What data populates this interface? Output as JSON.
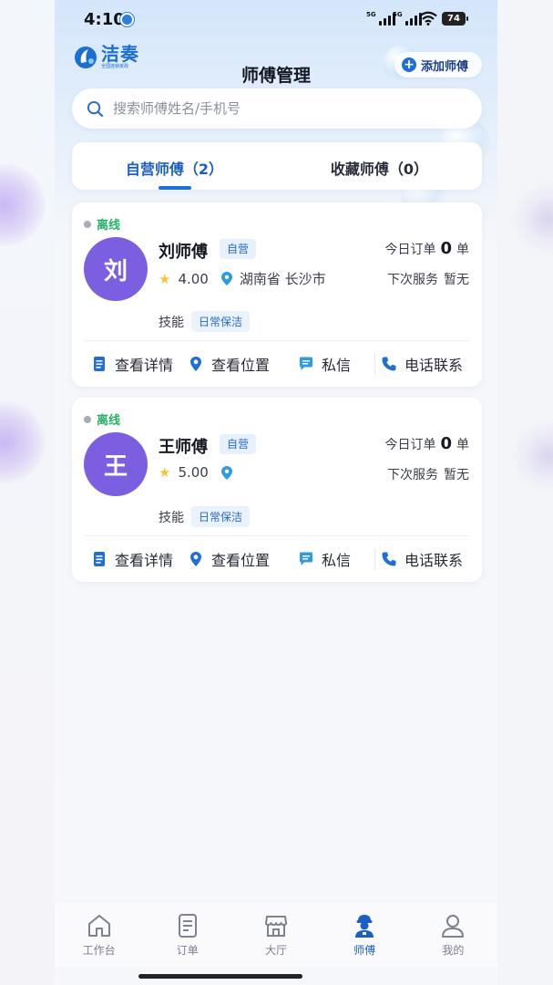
{
  "status_bar": {
    "time": "4:10",
    "signal1": "5G",
    "signal2": "5G",
    "battery": "74"
  },
  "header": {
    "logo_name": "洁奏",
    "logo_sub": "全国连锁家政",
    "title": "师傅管理",
    "add_button": "添加师傅"
  },
  "search": {
    "placeholder": "搜索师傅姓名/手机号",
    "value": ""
  },
  "tabs": [
    {
      "label": "自营师傅（2）",
      "active": true
    },
    {
      "label": "收藏师傅（0）",
      "active": false
    }
  ],
  "masters": [
    {
      "status": "离线",
      "avatar_char": "刘",
      "name": "刘师傅",
      "badge": "自营",
      "rating": "4.00",
      "location": "湖南省 长沙市",
      "orders_label": "今日订单",
      "orders_count": "0",
      "orders_unit": "单",
      "next_label": "下次服务",
      "next_value": "暂无",
      "skill_label": "技能",
      "skill_tag": "日常保洁"
    },
    {
      "status": "离线",
      "avatar_char": "王",
      "name": "王师傅",
      "badge": "自营",
      "rating": "5.00",
      "location": "",
      "orders_label": "今日订单",
      "orders_count": "0",
      "orders_unit": "单",
      "next_label": "下次服务",
      "next_value": "暂无",
      "skill_label": "技能",
      "skill_tag": "日常保洁"
    }
  ],
  "actions": {
    "detail": "查看详情",
    "location": "查看位置",
    "message": "私信",
    "phone": "电话联系"
  },
  "bottom_nav": [
    {
      "label": "工作台",
      "icon": "home-icon",
      "active": false
    },
    {
      "label": "订单",
      "icon": "order-icon",
      "active": false
    },
    {
      "label": "大厅",
      "icon": "store-icon",
      "active": false
    },
    {
      "label": "师傅",
      "icon": "worker-icon",
      "active": true
    },
    {
      "label": "我的",
      "icon": "user-icon",
      "active": false
    }
  ],
  "colors": {
    "accent": "#1f6fd6",
    "online_text": "#26b06a",
    "avatar_bg": "#7c5fe0",
    "star": "#f4c53a"
  }
}
